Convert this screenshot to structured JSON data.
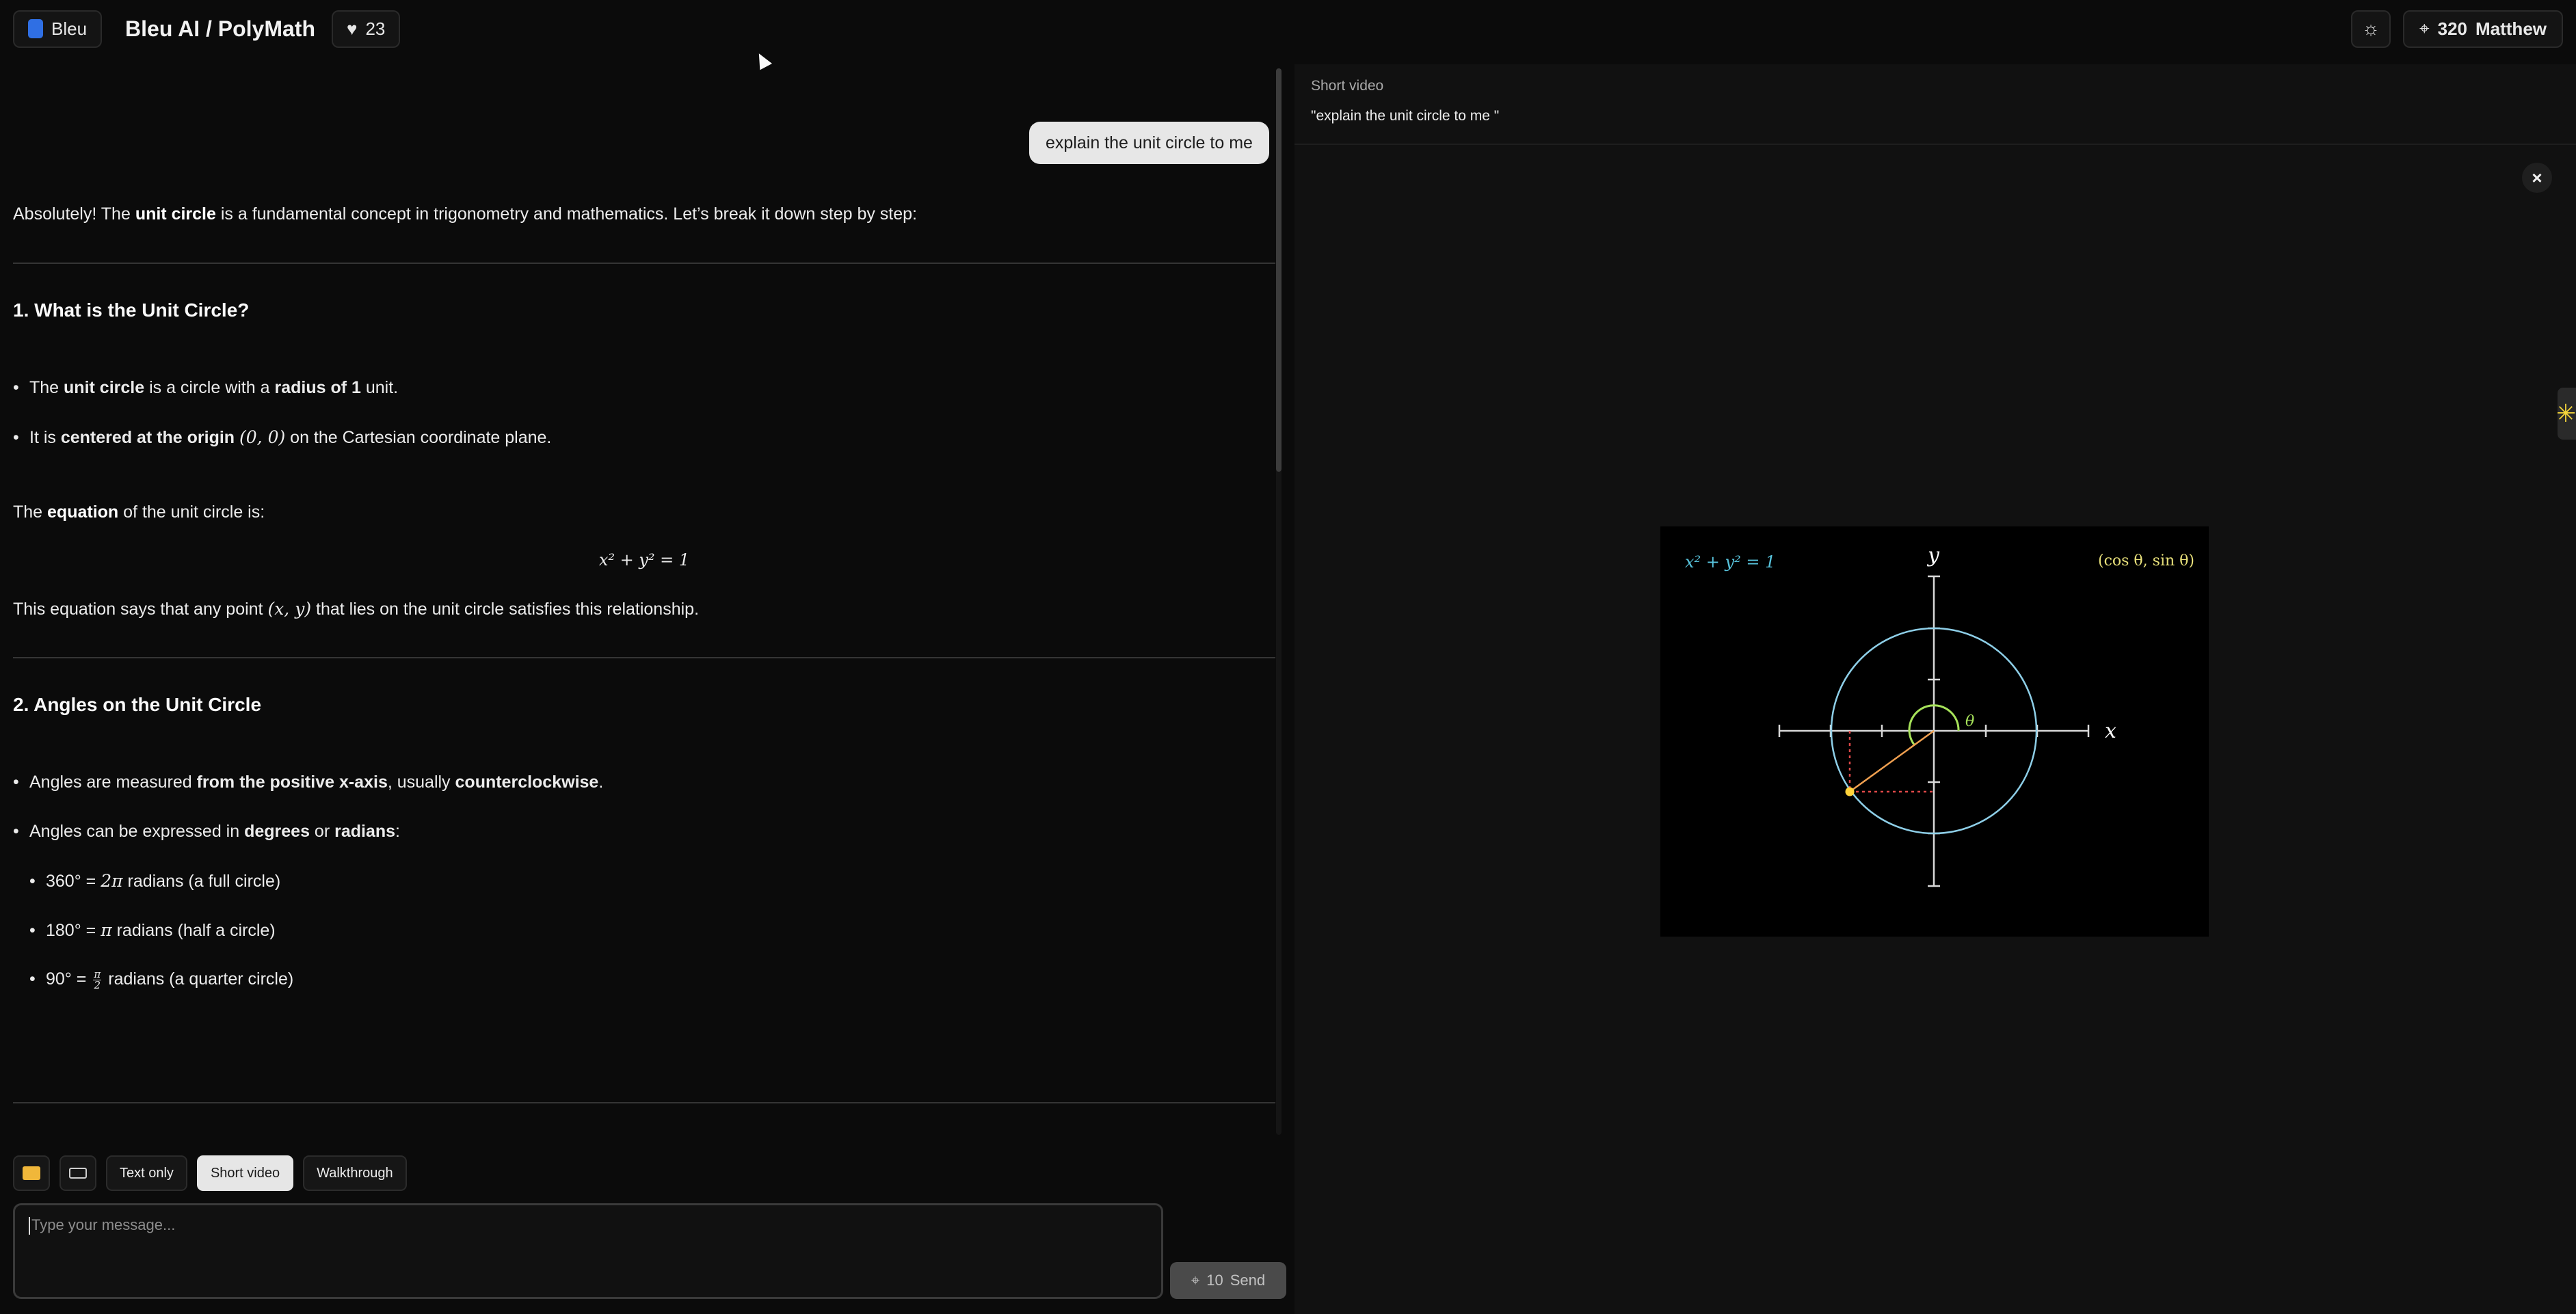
{
  "header": {
    "brand_label": "Bleu",
    "app_title": "Bleu AI / PolyMath",
    "likes": "23",
    "credits": "320",
    "user_name": "Matthew"
  },
  "chat": {
    "user_message": "explain the unit circle to me",
    "intro_pre": "Absolutely! The ",
    "intro_bold": "unit circle",
    "intro_post": " is a fundamental concept in trigonometry and mathematics. Let’s break it down step by step:",
    "section1": {
      "heading_num": "1. ",
      "heading": "What is the Unit Circle?",
      "b1_pre": "The ",
      "b1_bold1": "unit circle",
      "b1_mid": " is a circle with a ",
      "b1_bold2": "radius of 1",
      "b1_post": " unit.",
      "b2_pre": "It is ",
      "b2_bold": "centered at the origin",
      "b2_math": "(0, 0)",
      "b2_post": " on the Cartesian coordinate plane.",
      "eq_pre": "The ",
      "eq_bold": "equation",
      "eq_post": " of the unit circle is:",
      "equation": "x² + y² = 1",
      "note_pre": "This equation says that any point ",
      "note_math": "(x, y)",
      "note_post": " that lies on the unit circle satisfies this relationship."
    },
    "section2": {
      "heading_num": "2. ",
      "heading": "Angles on the Unit Circle",
      "b1_pre": "Angles are measured ",
      "b1_bold1": "from the positive x-axis",
      "b1_mid": ", usually ",
      "b1_bold2": "counterclockwise",
      "b1_post": ".",
      "b2_pre": "Angles can be expressed in ",
      "b2_bold1": "degrees",
      "b2_mid": " or ",
      "b2_bold2": "radians",
      "b2_post": ":",
      "s1_pre": "360° = ",
      "s1_math": "2π",
      "s1_post": " radians (a full circle)",
      "s2_pre": "180° = ",
      "s2_math": "π",
      "s2_post": " radians (half a circle)",
      "s3_pre": "90° = ",
      "s3_num": "π",
      "s3_den": "2",
      "s3_post": " radians (a quarter circle)"
    }
  },
  "composer": {
    "modes": [
      "Text only",
      "Short video",
      "Walkthrough"
    ],
    "active_mode": "Short video",
    "placeholder": "Type your message...",
    "send_cost": "10",
    "send_label": "Send"
  },
  "panel": {
    "kicker": "Short video",
    "prompt": "\"explain the unit circle to me \"",
    "close_label": "×",
    "video": {
      "eq_label": "x² + y² = 1",
      "point_label": "(cos θ, sin θ)",
      "x_label": "x",
      "y_label": "y",
      "theta_label": "θ",
      "colors": {
        "circle": "#8ecfe8",
        "eq_label": "#58c4dd",
        "point_label": "#e8e07a",
        "radius": "#f0a050",
        "point": "#ffd23a",
        "projection": "#e04848",
        "angle_arc": "#a7e35a"
      }
    }
  }
}
